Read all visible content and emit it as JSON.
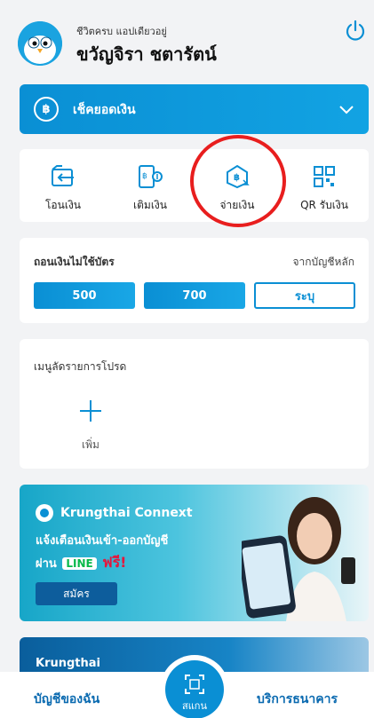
{
  "header": {
    "greeting": "ชีวิตครบ แอปเดียวอยู่",
    "user_name": "ขวัญจิรา ชตารัตน์"
  },
  "balance": {
    "label": "เช็คยอดเงิน",
    "currency_symbol": "฿"
  },
  "quick_actions": [
    {
      "label": "โอนเงิน",
      "icon": "transfer-icon"
    },
    {
      "label": "เติมเงิน",
      "icon": "topup-icon"
    },
    {
      "label": "จ่ายเงิน",
      "icon": "pay-icon"
    },
    {
      "label": "QR รับเงิน",
      "icon": "qr-icon"
    }
  ],
  "withdraw": {
    "title": "ถอนเงินไม่ใช้บัตร",
    "source": "จากบัญชีหลัก",
    "amounts": [
      "500",
      "700",
      "ระบุ"
    ]
  },
  "favorites": {
    "title": "เมนูลัดรายการโปรด",
    "add_label": "เพิ่ม"
  },
  "promo_banner": {
    "brand": "Krungthai Connext",
    "line1": "แจ้งเตือนเงินเข้า-ออกบัญชี",
    "line2_prefix": "ผ่าน",
    "line_badge": "LINE",
    "free": "ฟรี!",
    "button": "สมัคร"
  },
  "banner2": {
    "text": "Krungthai"
  },
  "bottom_nav": {
    "left": "บัญชีของฉัน",
    "scan": "สแกน",
    "right": "บริการธนาคาร"
  },
  "colors": {
    "primary": "#0a8fd4",
    "highlight": "#e81e1e"
  }
}
